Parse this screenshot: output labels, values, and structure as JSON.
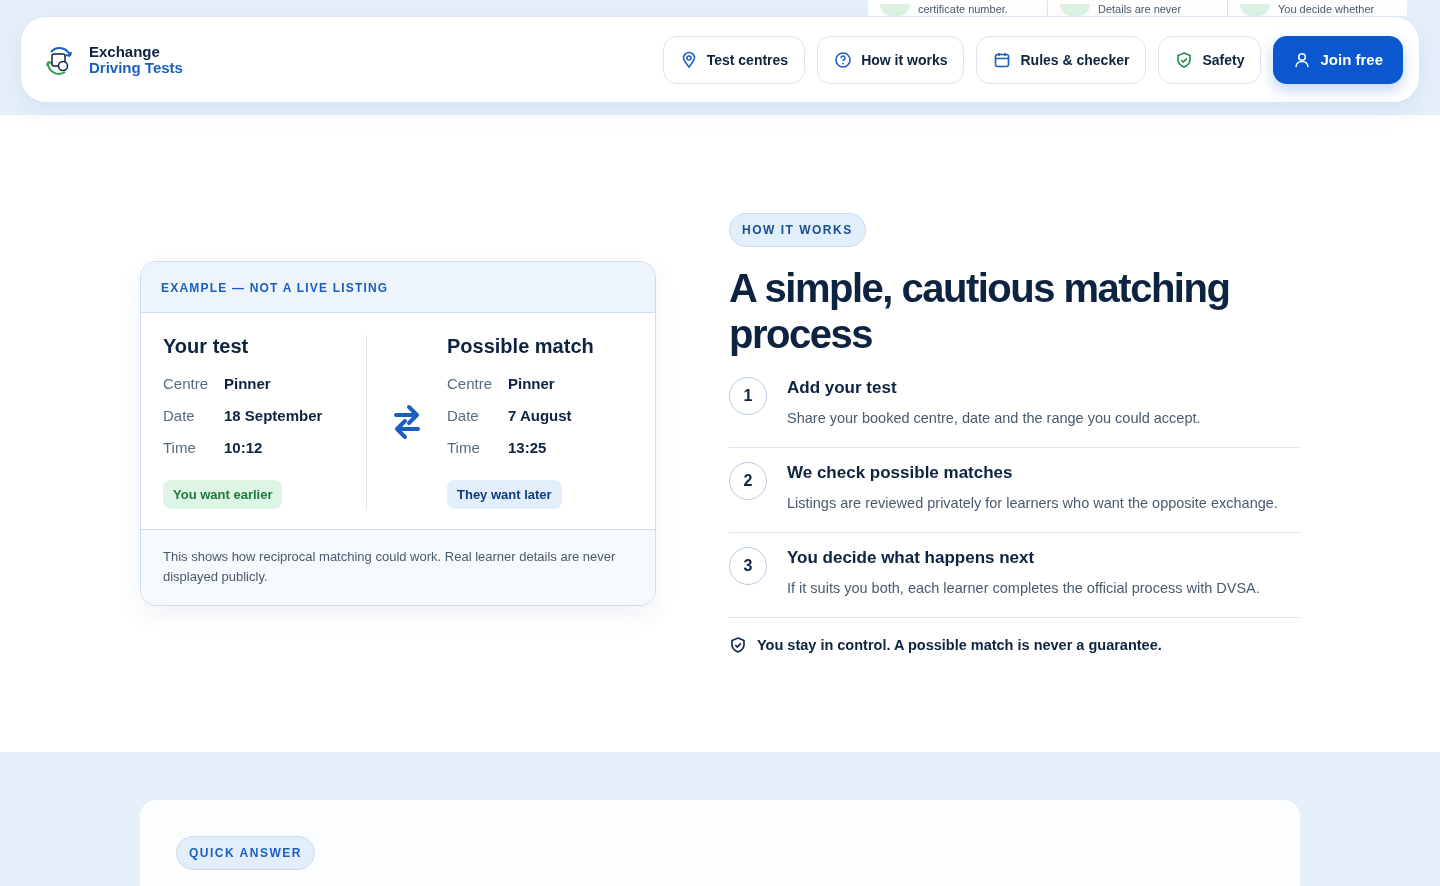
{
  "features": [
    {
      "text": "certificate number."
    },
    {
      "text": "Details are never"
    },
    {
      "text": "You decide whether"
    }
  ],
  "header": {
    "brand_line1": "Exchange",
    "brand_line2": "Driving Tests",
    "nav": [
      {
        "label": "Test centres",
        "kind": "pin"
      },
      {
        "label": "How it works",
        "kind": "question"
      },
      {
        "label": "Rules & checker",
        "kind": "calendar"
      },
      {
        "label": "Safety",
        "kind": "shield"
      }
    ],
    "cta": "Join free"
  },
  "example": {
    "label": "EXAMPLE — NOT A LIVE LISTING",
    "sides": [
      {
        "title": "Your test",
        "rows": [
          {
            "k": "Centre",
            "v": "Pinner"
          },
          {
            "k": "Date",
            "v": "18 September"
          },
          {
            "k": "Time",
            "v": "10:12"
          }
        ],
        "tag": "You want earlier",
        "kind": "earlier"
      },
      {
        "title": "Possible match",
        "rows": [
          {
            "k": "Centre",
            "v": "Pinner"
          },
          {
            "k": "Date",
            "v": "7 August"
          },
          {
            "k": "Time",
            "v": "13:25"
          }
        ],
        "tag": "They want later",
        "kind": "later"
      }
    ],
    "note": "This shows how reciprocal matching could work. Real learner details are never displayed publicly."
  },
  "how": {
    "eyebrow": "HOW IT WORKS",
    "title": "A simple, cautious matching process",
    "steps": [
      {
        "num": "1",
        "title": "Add your test",
        "text": "Share your booked centre, date and the range you could accept."
      },
      {
        "num": "2",
        "title": "We check possible matches",
        "text": "Listings are reviewed privately for learners who want the opposite exchange."
      },
      {
        "num": "3",
        "title": "You decide what happens next",
        "text": "If it suits you both, each learner completes the official process with DVSA."
      }
    ],
    "note": "You stay in control. A possible match is never a guarantee."
  },
  "quick": {
    "eyebrow": "QUICK ANSWER"
  }
}
